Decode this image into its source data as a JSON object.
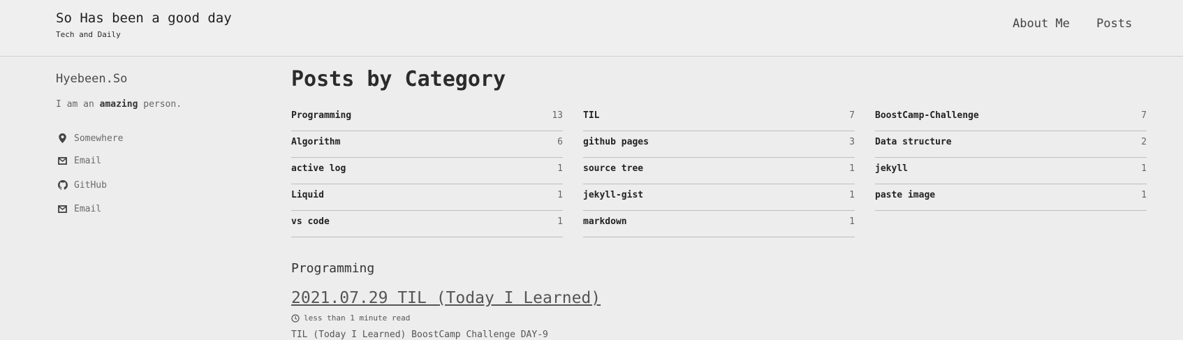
{
  "site": {
    "title": "So Has been a good day",
    "subtitle": "Tech and Daily"
  },
  "nav": {
    "items": [
      {
        "label": "About Me"
      },
      {
        "label": "Posts"
      }
    ]
  },
  "author": {
    "name": "Hyebeen.So",
    "bio_prefix": "I am an ",
    "bio_strong": "amazing",
    "bio_suffix": " person.",
    "links": [
      {
        "label": "Somewhere",
        "icon": "location-pin-icon"
      },
      {
        "label": "Email",
        "icon": "envelope-icon"
      },
      {
        "label": "GitHub",
        "icon": "github-icon"
      },
      {
        "label": "Email",
        "icon": "envelope-icon"
      }
    ]
  },
  "page": {
    "title": "Posts by Category"
  },
  "categories": {
    "columns": [
      [
        {
          "name": "Programming",
          "count": "13"
        },
        {
          "name": "Algorithm",
          "count": "6"
        },
        {
          "name": "active log",
          "count": "1"
        },
        {
          "name": "Liquid",
          "count": "1"
        },
        {
          "name": "vs code",
          "count": "1"
        }
      ],
      [
        {
          "name": "TIL",
          "count": "7"
        },
        {
          "name": "github pages",
          "count": "3"
        },
        {
          "name": "source tree",
          "count": "1"
        },
        {
          "name": "jekyll-gist",
          "count": "1"
        },
        {
          "name": "markdown",
          "count": "1"
        }
      ],
      [
        {
          "name": "BoostCamp-Challenge",
          "count": "7"
        },
        {
          "name": "Data structure",
          "count": "2"
        },
        {
          "name": "jekyll",
          "count": "1"
        },
        {
          "name": "paste image",
          "count": "1"
        }
      ]
    ]
  },
  "section": {
    "heading": "Programming",
    "post": {
      "title": "2021.07.29 TIL (Today I Learned)",
      "read_time": "less than 1 minute read",
      "excerpt": "TIL (Today I Learned) BoostCamp Challenge DAY-9"
    }
  },
  "colors": {
    "background": "#ededed",
    "divider": "#bdbdbd",
    "text": "#313131"
  }
}
